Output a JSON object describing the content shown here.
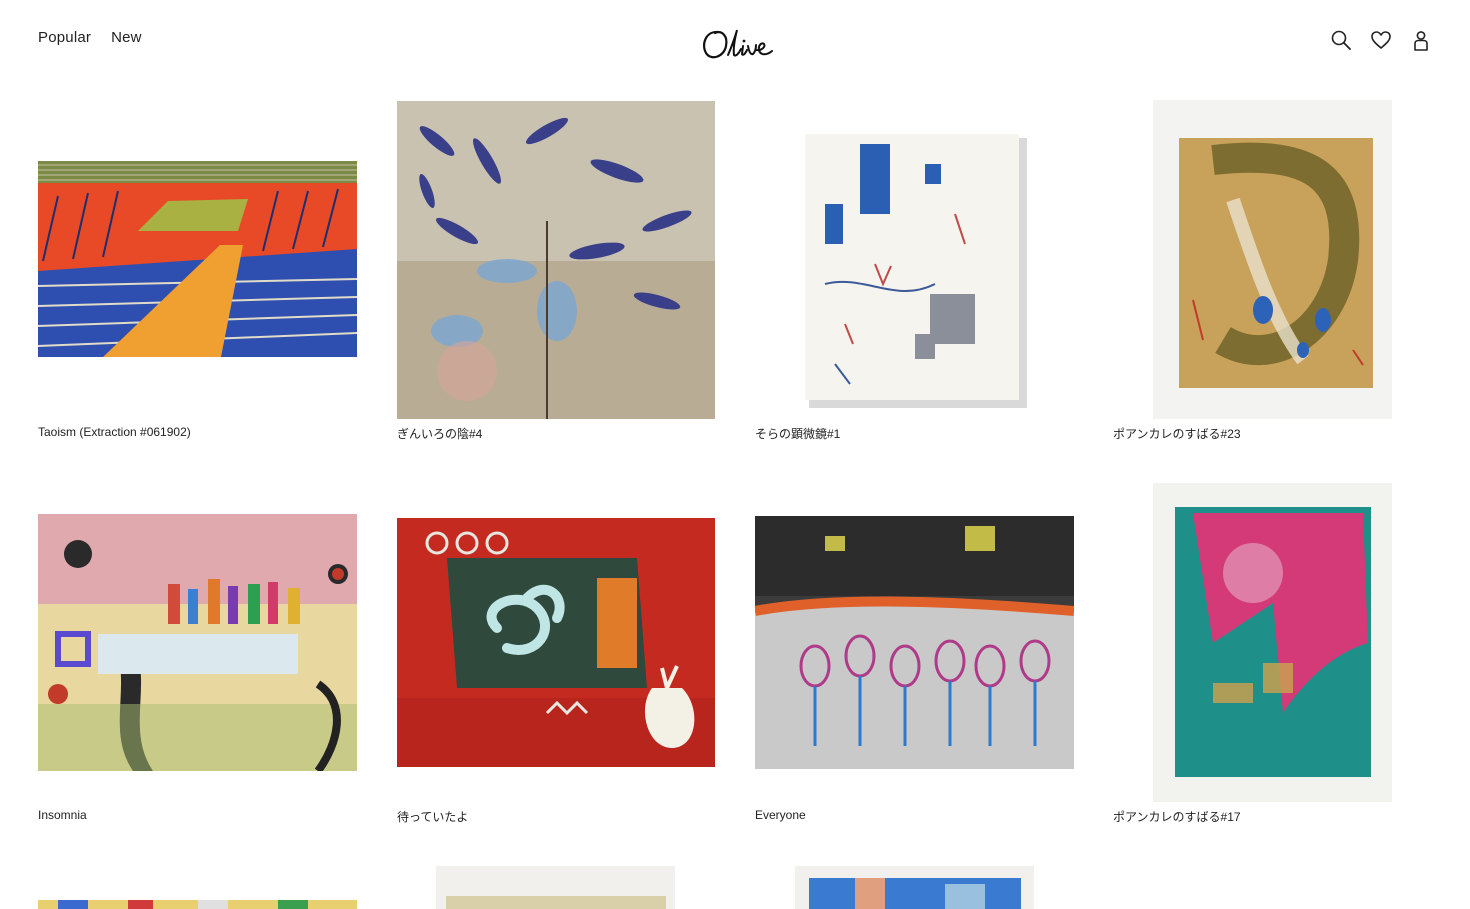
{
  "header": {
    "nav": [
      {
        "label": "Popular"
      },
      {
        "label": "New"
      }
    ],
    "logo_text": "Olive",
    "icons": [
      "search-icon",
      "heart-icon",
      "user-icon"
    ]
  },
  "artworks": [
    {
      "title": "Taoism (Extraction #061902)"
    },
    {
      "title": "ぎんいろの陰#4"
    },
    {
      "title": "そらの顕微鏡#1"
    },
    {
      "title": "ポアンカレのすばる#23"
    },
    {
      "title": "Insomnia"
    },
    {
      "title": "待っていたよ"
    },
    {
      "title": "Everyone"
    },
    {
      "title": "ポアンカレのすばる#17"
    }
  ]
}
